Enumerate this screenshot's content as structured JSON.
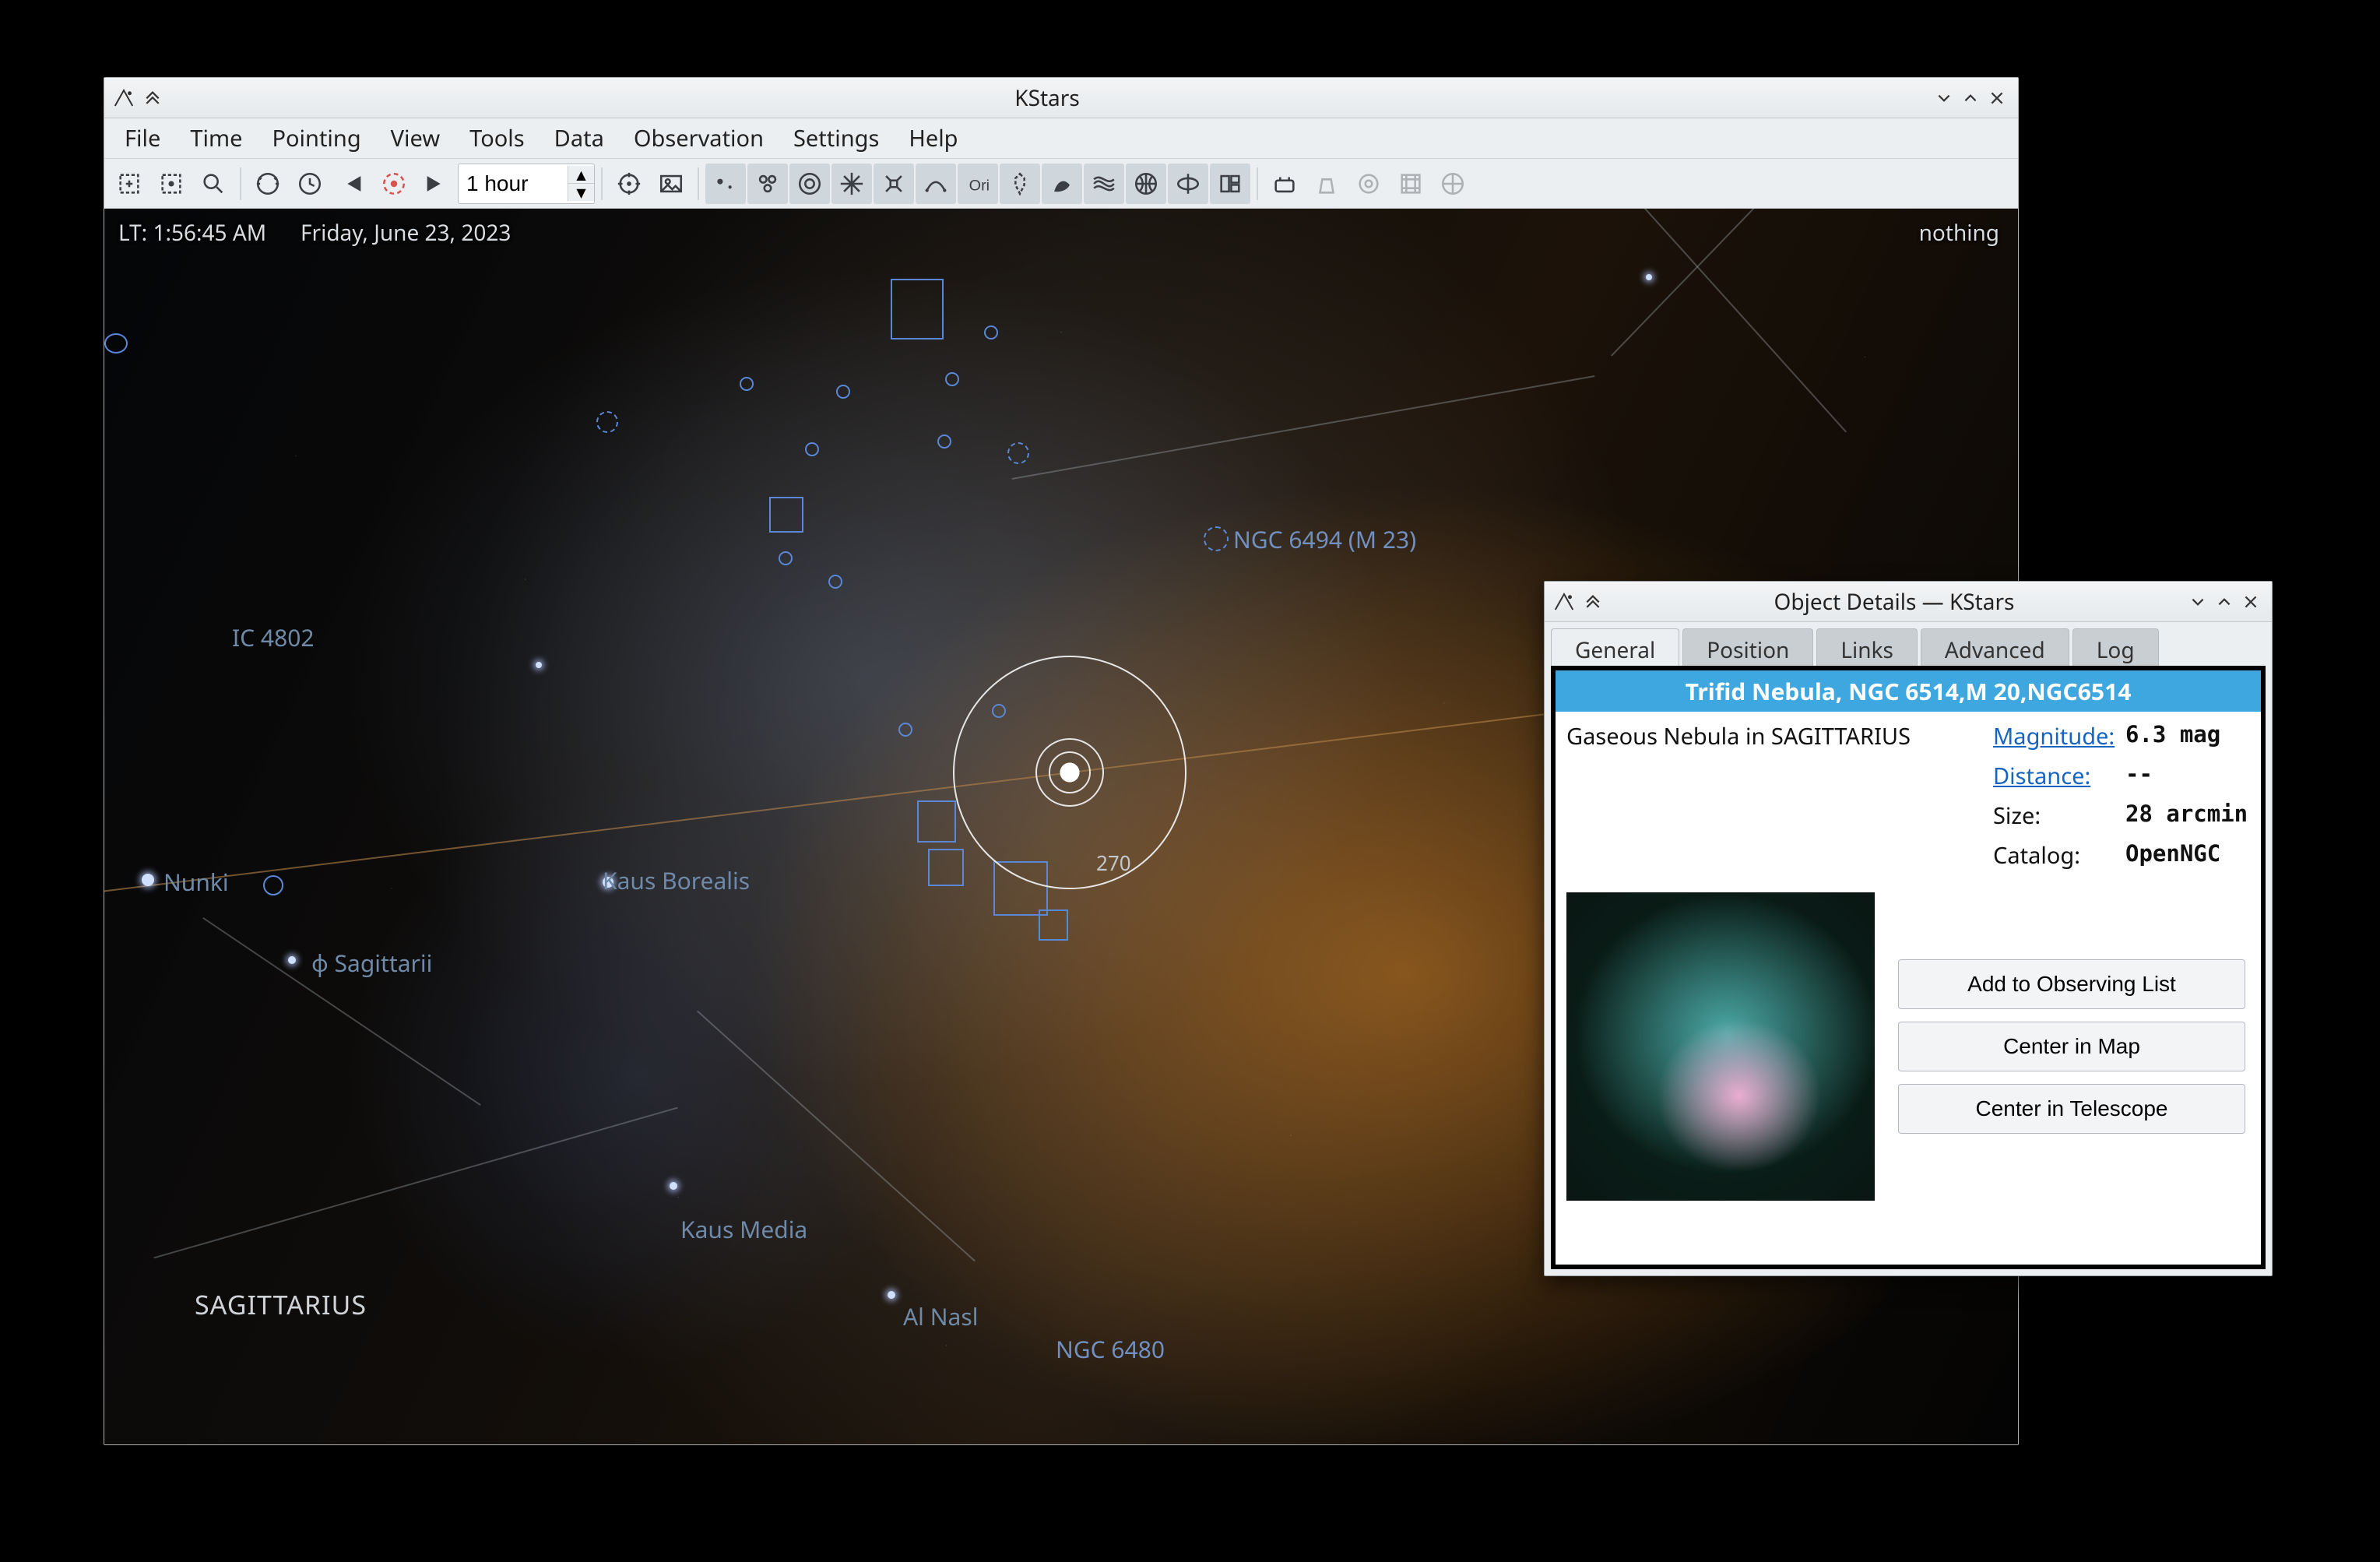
{
  "app": {
    "title": "KStars",
    "menus": [
      "File",
      "Time",
      "Pointing",
      "View",
      "Tools",
      "Data",
      "Observation",
      "Settings",
      "Help"
    ],
    "time_step": "1 hour"
  },
  "sky": {
    "local_time": "LT: 1:56:45 AM",
    "date": "Friday, June 23, 2023",
    "status_right": "nothing",
    "constellations": {
      "sagittarius": "SAGITTARIUS"
    },
    "labels": {
      "ngc6494": "NGC 6494 (M 23)",
      "ic4802": "IC 4802",
      "nunki": "Nunki",
      "phi_sgr": "φ Sagittarii",
      "kaus_borealis": "Kaus Borealis",
      "kaus_media": "Kaus Media",
      "al_nasl": "Al Nasl",
      "ngc6480": "NGC 6480"
    },
    "degree_marker": "270"
  },
  "details": {
    "title": "Object Details — KStars",
    "tabs": [
      "General",
      "Position",
      "Links",
      "Advanced",
      "Log"
    ],
    "active_tab": "General",
    "banner": "Trifid Nebula, NGC 6514,M 20,NGC6514",
    "desc": "Gaseous Nebula in SAGITTARIUS",
    "rows": {
      "magnitude_label": "Magnitude:",
      "magnitude_val": "6.3 mag",
      "distance_label": "Distance:",
      "distance_val": "--",
      "size_label": "Size:",
      "size_val": "28 arcmin",
      "catalog_label": "Catalog:",
      "catalog_val": "OpenNGC"
    },
    "buttons": {
      "add": "Add to Observing List",
      "center_map": "Center in Map",
      "center_tel": "Center in Telescope"
    }
  }
}
